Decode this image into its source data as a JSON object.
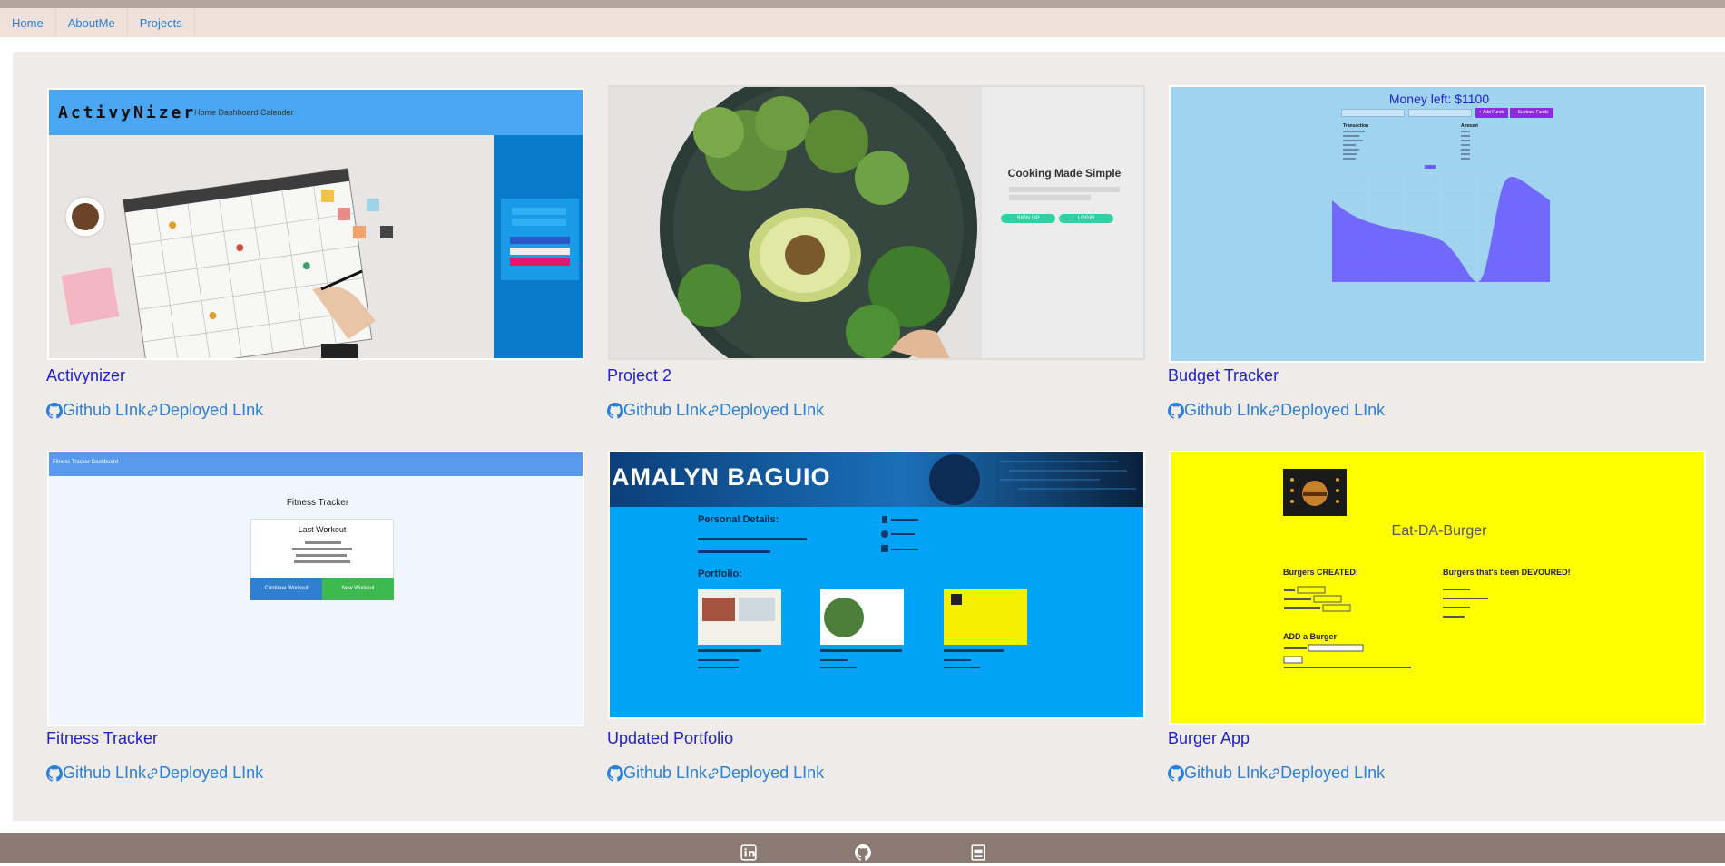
{
  "nav": {
    "items": [
      {
        "label": "Home"
      },
      {
        "label": "AboutMe"
      },
      {
        "label": "Projects"
      }
    ]
  },
  "colors": {
    "navbar_bg": "#efe0da",
    "content_bg": "#efebe9",
    "title_link": "#2222cc",
    "link": "#2a7fd6",
    "footer_bg": "#8b7a72"
  },
  "projects": [
    {
      "title": "Activynizer",
      "github_label": "Github LInk",
      "deployed_label": "Deployed LInk",
      "thumb": {
        "logo": "ActivyNizer",
        "menu": "Home  Dashboard  Calender"
      }
    },
    {
      "title": "Project 2",
      "github_label": "Github LInk",
      "deployed_label": "Deployed LInk",
      "thumb": {
        "heading": "Cooking Made Simple",
        "sign_up": "SIGN UP",
        "login": "LOGIN"
      }
    },
    {
      "title": "Budget Tracker",
      "github_label": "Github LInk",
      "deployed_label": "Deployed LInk",
      "thumb": {
        "heading": "Money left: $1100",
        "add_funds": "+ Add Funds",
        "subtract_funds": "- Subtract Funds",
        "col_transaction": "Transaction",
        "col_amount": "Amount"
      }
    },
    {
      "title": "Fitness Tracker",
      "github_label": "Github LInk",
      "deployed_label": "Deployed LInk",
      "thumb": {
        "bar": "Fitness Tracker Dashboard",
        "heading": "Fitness Tracker",
        "card_title": "Last Workout",
        "continue": "Continue Workout",
        "new": "New Workout"
      }
    },
    {
      "title": "Updated Portfolio",
      "github_label": "Github LInk",
      "deployed_label": "Deployed LInk",
      "thumb": {
        "name": "AMALYN BAGUIO",
        "personal": "Personal Details:",
        "portfolio": "Portfolio:"
      }
    },
    {
      "title": "Burger App",
      "github_label": "Github LInk",
      "deployed_label": "Deployed LInk",
      "thumb": {
        "heading": "Eat-DA-Burger",
        "created": "Burgers CREATED!",
        "devoured": "Burgers that's been DEVOURED!",
        "add": "ADD a Burger"
      }
    }
  ],
  "footer": {
    "icons": [
      "linkedin-icon",
      "github-icon",
      "pdf-icon"
    ]
  }
}
